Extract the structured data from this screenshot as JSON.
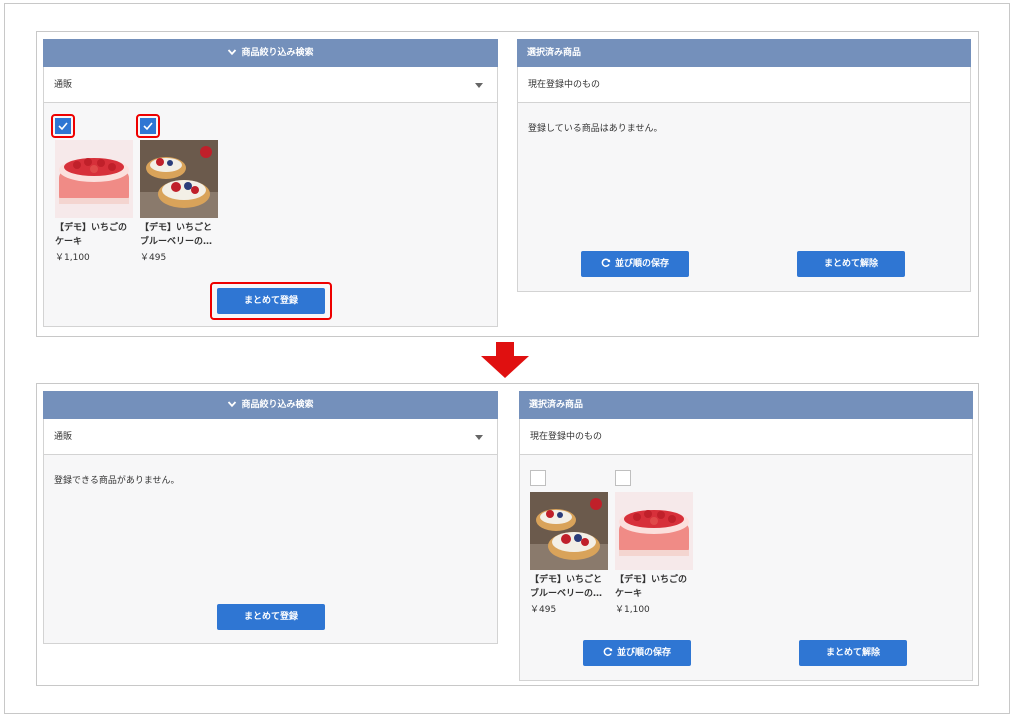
{
  "search_panel": {
    "title": "商品絞り込み検索",
    "dropdown_value": "通販",
    "empty_message": "登録できる商品がありません。",
    "register_button": "まとめて登録"
  },
  "selected_panel": {
    "title": "選択済み商品",
    "subheader": "現在登録中のもの",
    "empty_message": "登録している商品はありません。",
    "save_order_button": "並び順の保存",
    "release_button": "まとめて解除"
  },
  "products": {
    "cake": {
      "name_line1": "【デモ】いちごの",
      "name_line2": "ケーキ",
      "price": "￥1,100"
    },
    "tart": {
      "name_line1": "【デモ】いちごと",
      "name_line2": "ブルーベリーの…",
      "price": "￥495"
    }
  },
  "colors": {
    "header": "#7490bb",
    "button": "#2f76d3",
    "highlight": "#e00000",
    "arrow": "#e01010"
  }
}
